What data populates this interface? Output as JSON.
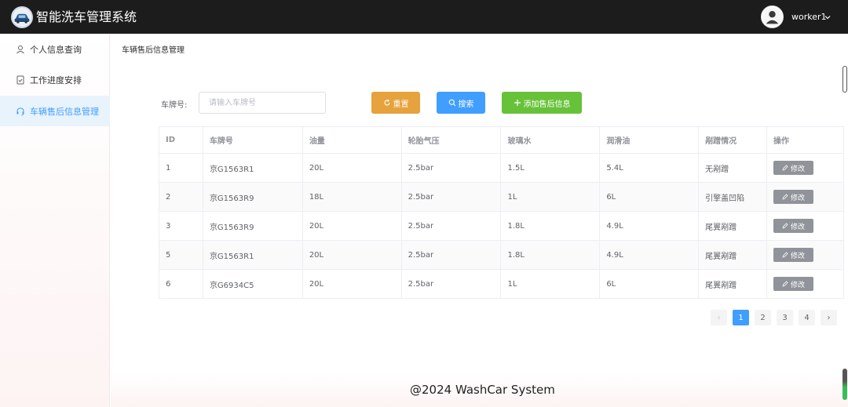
{
  "header": {
    "app_title": "智能洗车管理系统",
    "username": "worker1"
  },
  "sidebar": {
    "items": [
      {
        "label": "个人信息查询",
        "icon": "user-icon",
        "active": false
      },
      {
        "label": "工作进度安排",
        "icon": "document-check-icon",
        "active": false
      },
      {
        "label": "车辆售后信息管理",
        "icon": "headset-icon",
        "active": true
      }
    ]
  },
  "main": {
    "breadcrumb": "车辆售后信息管理",
    "search": {
      "label": "车牌号:",
      "placeholder": "请输入车牌号",
      "value": ""
    },
    "buttons": {
      "reset": "重置",
      "search": "搜索",
      "add": "添加售后信息"
    },
    "table": {
      "headers": [
        "ID",
        "车牌号",
        "油量",
        "轮胎气压",
        "玻璃水",
        "润滑油",
        "剐蹭情况",
        "操作"
      ],
      "rows": [
        {
          "id": "1",
          "plate": "京G1563R1",
          "fuel": "20L",
          "tire": "2.5bar",
          "washer": "1.5L",
          "lube": "5.4L",
          "scratch": "无剐蹭",
          "action": "修改"
        },
        {
          "id": "2",
          "plate": "京G1563R9",
          "fuel": "18L",
          "tire": "2.5bar",
          "washer": "1L",
          "lube": "6L",
          "scratch": "引擎盖凹陷",
          "action": "修改"
        },
        {
          "id": "3",
          "plate": "京G1563R9",
          "fuel": "20L",
          "tire": "2.5bar",
          "washer": "1.8L",
          "lube": "4.9L",
          "scratch": "尾翼剐蹭",
          "action": "修改"
        },
        {
          "id": "5",
          "plate": "京G1563R1",
          "fuel": "20L",
          "tire": "2.5bar",
          "washer": "1.8L",
          "lube": "4.9L",
          "scratch": "尾翼剐蹭",
          "action": "修改"
        },
        {
          "id": "6",
          "plate": "京G6934C5",
          "fuel": "20L",
          "tire": "2.5bar",
          "washer": "1L",
          "lube": "6L",
          "scratch": "尾翼剐蹭",
          "action": "修改"
        }
      ]
    },
    "pagination": {
      "prev": "‹",
      "pages": [
        "1",
        "2",
        "3",
        "4"
      ],
      "current": "1",
      "next": "›"
    }
  },
  "footer": {
    "text": "@2024 WashCar System"
  },
  "colors": {
    "header_bg": "#1c1c1c",
    "primary": "#409eff",
    "warning": "#e6a23c",
    "success": "#67c23a",
    "info": "#909399"
  }
}
